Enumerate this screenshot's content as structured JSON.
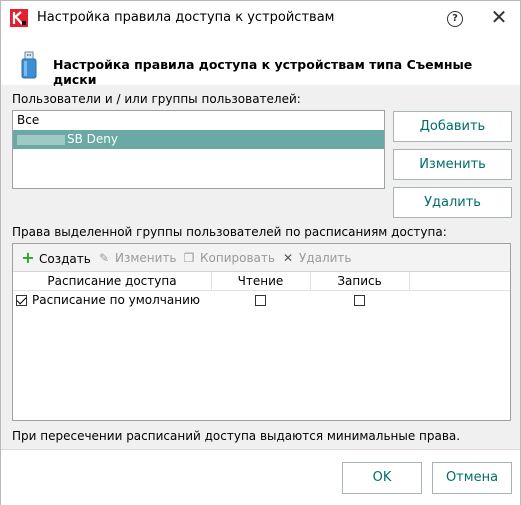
{
  "window": {
    "title": "Настройка правила доступа к устройствам",
    "help_glyph": "?",
    "close_glyph": "✕"
  },
  "header": {
    "title": "Настройка правила доступа к устройствам типа Съемные диски"
  },
  "users": {
    "label": "Пользователи и / или группы пользователей:",
    "items": [
      {
        "label": "Все"
      },
      {
        "label": "SB Deny"
      }
    ]
  },
  "user_buttons": {
    "add": "Добавить",
    "edit": "Изменить",
    "remove": "Удалить"
  },
  "schedule": {
    "label": "Права выделенной группы пользователей по расписаниям доступа:",
    "toolbar": {
      "create": "Создать",
      "edit": "Изменить",
      "copy": "Копировать",
      "delete": "Удалить"
    },
    "columns": {
      "schedule": "Расписание доступа",
      "read": "Чтение",
      "write": "Запись"
    },
    "rows": [
      {
        "name": "Расписание по умолчанию",
        "checked": true,
        "read": false,
        "write": false
      }
    ]
  },
  "note": "При пересечении расписаний доступа выдаются минимальные права.",
  "footer": {
    "ok": "OK",
    "cancel": "Отмена"
  },
  "colors": {
    "accent": "#006d6b",
    "selection": "#6aa9a6",
    "brand_red": "#e3202d"
  }
}
